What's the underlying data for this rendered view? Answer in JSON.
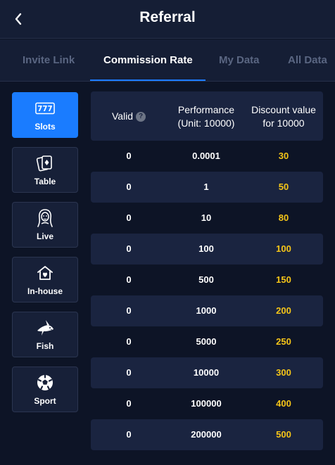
{
  "header": {
    "title": "Referral",
    "back_icon": "chevron-left-icon"
  },
  "tabs": [
    {
      "label": "Invite Link",
      "active": false
    },
    {
      "label": "Commission Rate",
      "active": true
    },
    {
      "label": "My Data",
      "active": false
    },
    {
      "label": "All Data",
      "active": false
    }
  ],
  "categories": [
    {
      "label": "Slots",
      "icon": "slots-777-icon",
      "active": true
    },
    {
      "label": "Table",
      "icon": "playing-cards-icon",
      "active": false
    },
    {
      "label": "Live",
      "icon": "dealer-woman-icon",
      "active": false
    },
    {
      "label": "In-house",
      "icon": "house-heart-icon",
      "active": false
    },
    {
      "label": "Fish",
      "icon": "shark-icon",
      "active": false
    },
    {
      "label": "Sport",
      "icon": "soccer-ball-icon",
      "active": false
    }
  ],
  "table": {
    "headers": {
      "valid": "Valid",
      "performance_line1": "Performance",
      "performance_line2": "(Unit: 10000)",
      "discount_line1": "Discount value",
      "discount_line2": "for 10000",
      "help_icon": "question-mark-icon"
    },
    "rows": [
      {
        "valid": "0",
        "performance": "0.0001",
        "discount": "30"
      },
      {
        "valid": "0",
        "performance": "1",
        "discount": "50"
      },
      {
        "valid": "0",
        "performance": "10",
        "discount": "80"
      },
      {
        "valid": "0",
        "performance": "100",
        "discount": "100"
      },
      {
        "valid": "0",
        "performance": "500",
        "discount": "150"
      },
      {
        "valid": "0",
        "performance": "1000",
        "discount": "200"
      },
      {
        "valid": "0",
        "performance": "5000",
        "discount": "250"
      },
      {
        "valid": "0",
        "performance": "10000",
        "discount": "300"
      },
      {
        "valid": "0",
        "performance": "100000",
        "discount": "400"
      },
      {
        "valid": "0",
        "performance": "200000",
        "discount": "500"
      }
    ]
  },
  "colors": {
    "background": "#0d1426",
    "header_bg": "#151e35",
    "accent": "#1a7cff",
    "discount_text": "#f5c518",
    "row_alt": "#1a2440",
    "inactive_tab": "#5a6682"
  }
}
